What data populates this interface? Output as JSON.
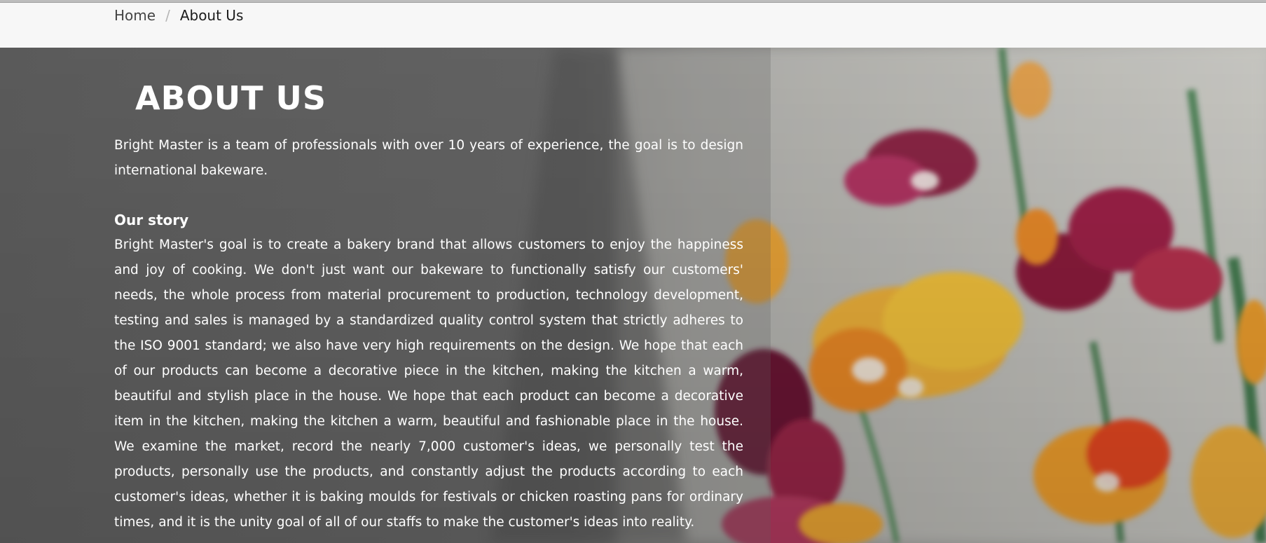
{
  "breadcrumb": {
    "home_label": "Home",
    "separator": "/",
    "current_label": "About Us"
  },
  "hero": {
    "title": "ABOUT US",
    "intro": "Bright Master is a team of professionals with over 10 years of experience, the goal is to design international bakeware.",
    "story_heading": "Our story",
    "story_body": "Bright Master's goal is to create a bakery brand that allows customers to enjoy the happiness and joy of cooking. We don't just want our bakeware to functionally satisfy our customers' needs, the whole process from material procurement to production, technology development, testing and sales is managed by a standardized quality control system that strictly adheres to the ISO 9001 standard; we also have very high requirements on the design. We hope that each of our products can become a decorative piece in the kitchen, making the kitchen a warm, beautiful and stylish place in the house. We hope that each product can become a decorative item in the kitchen, making the kitchen a warm, beautiful and fashionable place in the house. We examine the market, record the nearly 7,000 customer's ideas, we personally test the products, personally use the products, and constantly adjust the products according to each customer's ideas, whether it is baking moulds for festivals or chicken roasting pans for ordinary times, and it is the unity goal of all of our staffs to make the customer's ideas into reality."
  },
  "colors": {
    "breadcrumb_bg": "#f7f7f7",
    "hero_overlay": "#6d6d6d",
    "text_on_hero": "#ffffff"
  }
}
